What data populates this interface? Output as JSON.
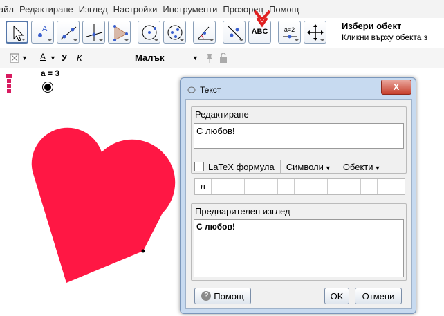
{
  "menu": [
    "Файл",
    "Редактиране",
    "Изглед",
    "Настройки",
    "Инструменти",
    "Прозорец",
    "Помощ"
  ],
  "toolbar": {
    "abc_label": "ABC",
    "a2_label": "a=2",
    "tool_title": "Избери обект",
    "tool_desc": "Кликни върху обекта з"
  },
  "stylebar": {
    "bold": "У",
    "italic": "К",
    "font_size": "Малък"
  },
  "graphics": {
    "slider_label": "a = 3",
    "heart_color": "#ff1744"
  },
  "dialog": {
    "title": "Текст",
    "close_label": "X",
    "edit_label": "Редактиране",
    "edit_text": "С любов!",
    "latex_label": "LaTeX формула",
    "symbols_label": "Символи",
    "objects_label": "Обекти",
    "symbols": [
      "π",
      "",
      "",
      "",
      "",
      "",
      "",
      "",
      "",
      "",
      "",
      ""
    ],
    "preview_label": "Предварителен изглед",
    "preview_text": "С любов!",
    "help_label": "Помощ",
    "ok_label": "OK",
    "cancel_label": "Отмени"
  }
}
